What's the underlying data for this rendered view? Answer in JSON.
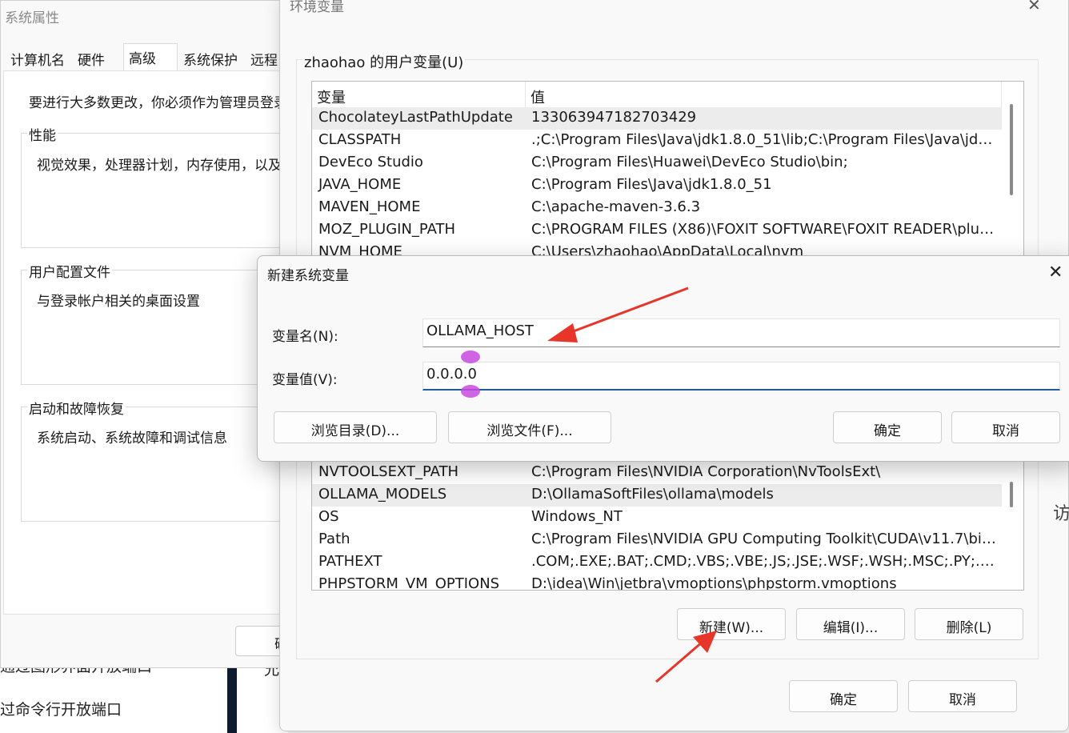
{
  "background": {
    "line1": "通过图形界面开放端口",
    "line2": "过命令行开放端口",
    "line3": "允",
    "edge": "访"
  },
  "sys_props": {
    "title": "系统属性",
    "tabs": [
      "计算机名",
      "硬件",
      "高级",
      "系统保护",
      "远程"
    ],
    "active_tab": "高级",
    "admin_note": "要进行大多数更改，你必须作为管理员登录。",
    "groups": [
      {
        "label": "性能",
        "desc": "视觉效果，处理器计划，内存使用，以及虚拟内存"
      },
      {
        "label": "用户配置文件",
        "desc": "与登录帐户相关的桌面设置"
      },
      {
        "label": "启动和故障恢复",
        "desc": "系统启动、系统故障和调试信息"
      }
    ],
    "bottom_button": "确定"
  },
  "env_vars": {
    "title": "环境变量",
    "user_vars_label": "zhaohao 的用户变量(U)",
    "col_var": "变量",
    "col_val": "值",
    "rows_top": [
      {
        "name": "ChocolateyLastPathUpdate",
        "value": "133063947182703429"
      },
      {
        "name": "CLASSPATH",
        "value": ".;C:\\Program Files\\Java\\jdk1.8.0_51\\lib;C:\\Program Files\\Java\\jdk1...."
      },
      {
        "name": "DevEco Studio",
        "value": "C:\\Program Files\\Huawei\\DevEco Studio\\bin;"
      },
      {
        "name": "JAVA_HOME",
        "value": "C:\\Program Files\\Java\\jdk1.8.0_51"
      },
      {
        "name": "MAVEN_HOME",
        "value": "C:\\apache-maven-3.6.3"
      },
      {
        "name": "MOZ_PLUGIN_PATH",
        "value": "C:\\PROGRAM FILES (X86)\\FOXIT SOFTWARE\\FOXIT READER\\plugi..."
      },
      {
        "name": "NVM_HOME",
        "value": "C:\\Users\\zhaohao\\AppData\\Local\\nvm"
      }
    ],
    "rows_bottom": [
      {
        "name": "NVTOOLSEXT_PATH",
        "value": "C:\\Program Files\\NVIDIA Corporation\\NvToolsExt\\"
      },
      {
        "name": "OLLAMA_MODELS",
        "value": "D:\\OllamaSoftFiles\\ollama\\models"
      },
      {
        "name": "OS",
        "value": "Windows_NT"
      },
      {
        "name": "Path",
        "value": "C:\\Program Files\\NVIDIA GPU Computing Toolkit\\CUDA\\v11.7\\bin..."
      },
      {
        "name": "PATHEXT",
        "value": ".COM;.EXE;.BAT;.CMD;.VBS;.VBE;.JS;.JSE;.WSF;.WSH;.MSC;.PY;.PYW"
      },
      {
        "name": "PHPSTORM_VM_OPTIONS",
        "value": "D:\\idea\\Win\\jetbra\\vmoptions\\phpstorm.vmoptions"
      }
    ],
    "btn_new": "新建(W)...",
    "btn_edit": "编辑(I)...",
    "btn_delete": "删除(L)",
    "btn_ok": "确定",
    "btn_cancel": "取消"
  },
  "new_var_dialog": {
    "title": "新建系统变量",
    "name_label": "变量名(N):",
    "name_value": "OLLAMA_HOST",
    "value_label": "变量值(V):",
    "value_value": "0.0.0.0",
    "btn_browse_dir": "浏览目录(D)...",
    "btn_browse_file": "浏览文件(F)...",
    "btn_ok": "确定",
    "btn_cancel": "取消"
  },
  "colors": {
    "annotation_arrow": "#e8352a",
    "caret_handle": "#c84be0",
    "focus_underline": "#1f5a9b"
  }
}
